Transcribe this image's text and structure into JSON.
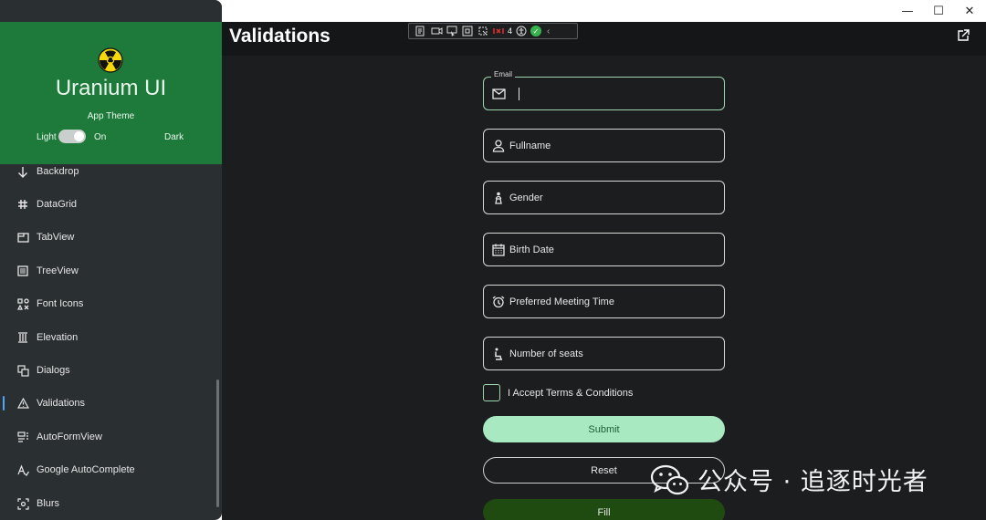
{
  "window": {
    "min_glyph": "—",
    "max_glyph": "☐",
    "close_glyph": "✕"
  },
  "header": {
    "title": "Validations"
  },
  "devtools": {
    "counter": "4"
  },
  "sidebar": {
    "app_name": "Uranium UI",
    "theme_label": "App Theme",
    "light_label": "Light",
    "toggle_state": "On",
    "dark_label": "Dark",
    "items": [
      {
        "label": "Backdrop",
        "icon": "arrow-down-icon"
      },
      {
        "label": "DataGrid",
        "icon": "grid-hash-icon"
      },
      {
        "label": "TabView",
        "icon": "tab-icon"
      },
      {
        "label": "TreeView",
        "icon": "tree-list-icon"
      },
      {
        "label": "Font Icons",
        "icon": "font-icons-icon"
      },
      {
        "label": "Elevation",
        "icon": "pillars-icon"
      },
      {
        "label": "Dialogs",
        "icon": "dialogs-icon"
      },
      {
        "label": "Validations",
        "icon": "warning-triangle-icon",
        "selected": true
      },
      {
        "label": "AutoFormView",
        "icon": "form-icon"
      },
      {
        "label": "Google AutoComplete",
        "icon": "autocomplete-icon"
      },
      {
        "label": "Blurs",
        "icon": "blur-icon"
      }
    ]
  },
  "form": {
    "email_legend": "Email",
    "email_value": "",
    "fullname": "Fullname",
    "gender": "Gender",
    "birth_date": "Birth Date",
    "meeting_time": "Preferred Meeting Time",
    "seats": "Number of seats",
    "terms": "I Accept Terms & Conditions",
    "terms_checked": false,
    "submit": "Submit",
    "reset": "Reset",
    "fill": "Fill"
  },
  "watermark": {
    "text": "公众号 · 追逐时光者"
  },
  "colors": {
    "sidebar_header": "#1e7a3a",
    "sidebar_bg": "#2a2f32",
    "main_bg": "#1c1d1f",
    "submit_bg": "#a9e9c1",
    "fill_bg": "#1f4b10",
    "focus_border": "#9fd6b2"
  }
}
